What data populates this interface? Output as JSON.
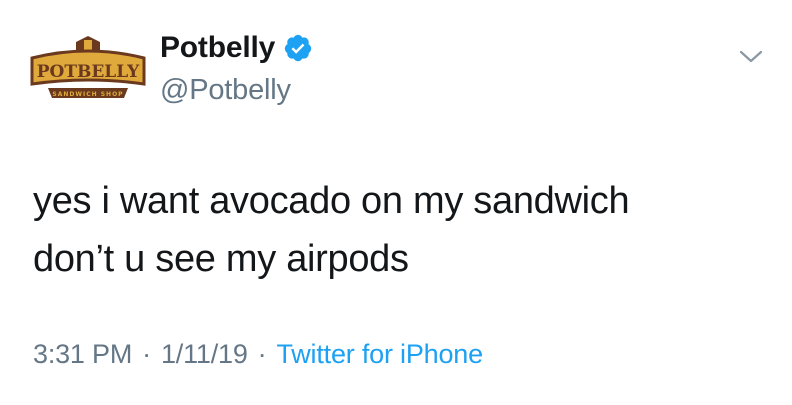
{
  "account": {
    "display_name": "Potbelly",
    "handle": "@Potbelly",
    "verified": true,
    "logo": {
      "wordmark": "POTBELLY",
      "tagline": "SANDWICH SHOP"
    }
  },
  "tweet": {
    "lines": [
      "yes i want avocado on my sandwich",
      "don’t u see my airpods"
    ]
  },
  "meta": {
    "time": "3:31 PM",
    "separator": "·",
    "date": "1/11/19",
    "source": "Twitter for iPhone"
  },
  "colors": {
    "verified_badge": "#1da1f2",
    "source_link": "#1da1f2",
    "secondary_text": "#657786",
    "logo_brown": "#6b3a1e",
    "logo_gold": "#e0a93b"
  },
  "icons": {
    "verified": "verified-badge-icon",
    "menu": "chevron-down-icon"
  }
}
